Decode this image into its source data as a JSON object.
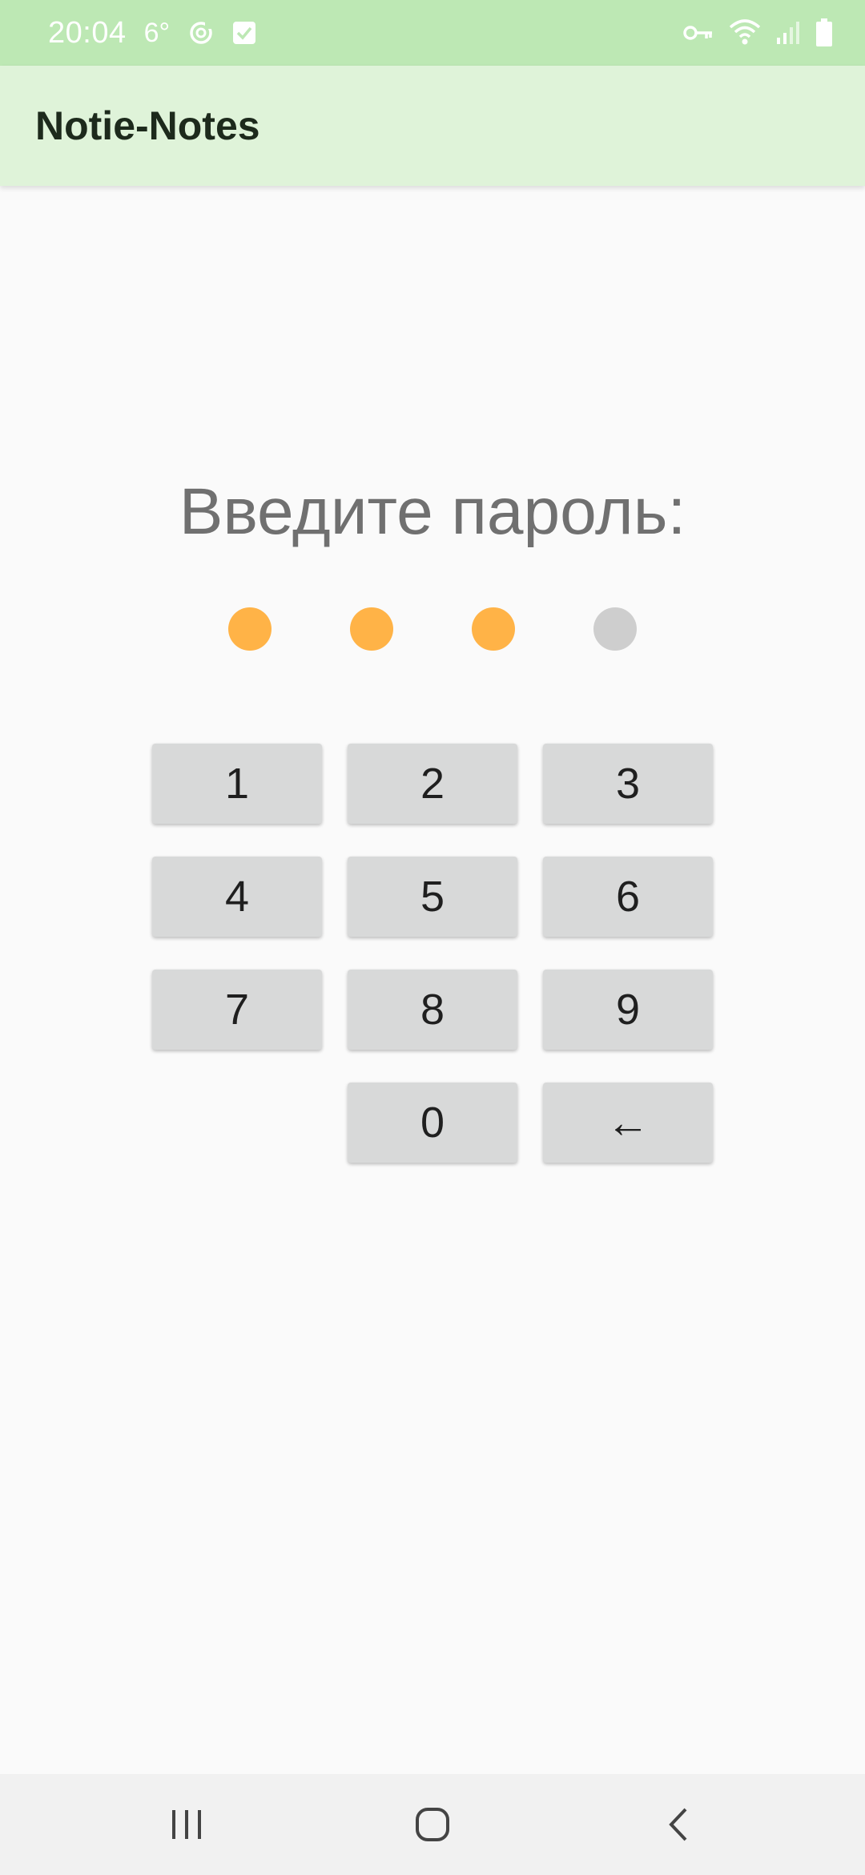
{
  "status_bar": {
    "time": "20:04",
    "temperature": "6°",
    "icons_left": [
      "weather-icon",
      "sync-icon",
      "check-icon"
    ],
    "icons_right": [
      "vpn-key-icon",
      "wifi-icon",
      "signal-icon",
      "battery-icon"
    ]
  },
  "app_bar": {
    "title": "Notie-Notes",
    "background": "#dff3d9"
  },
  "pin_screen": {
    "prompt": "Введите пароль:",
    "pin_length": 4,
    "entered_count": 3,
    "filled_color": "#ffb347",
    "empty_color": "#cecece"
  },
  "keypad": {
    "keys": [
      "1",
      "2",
      "3",
      "4",
      "5",
      "6",
      "7",
      "8",
      "9",
      "",
      "0",
      "←"
    ]
  },
  "nav_bar": {
    "buttons": [
      "recent-apps-icon",
      "home-icon",
      "back-icon"
    ]
  }
}
